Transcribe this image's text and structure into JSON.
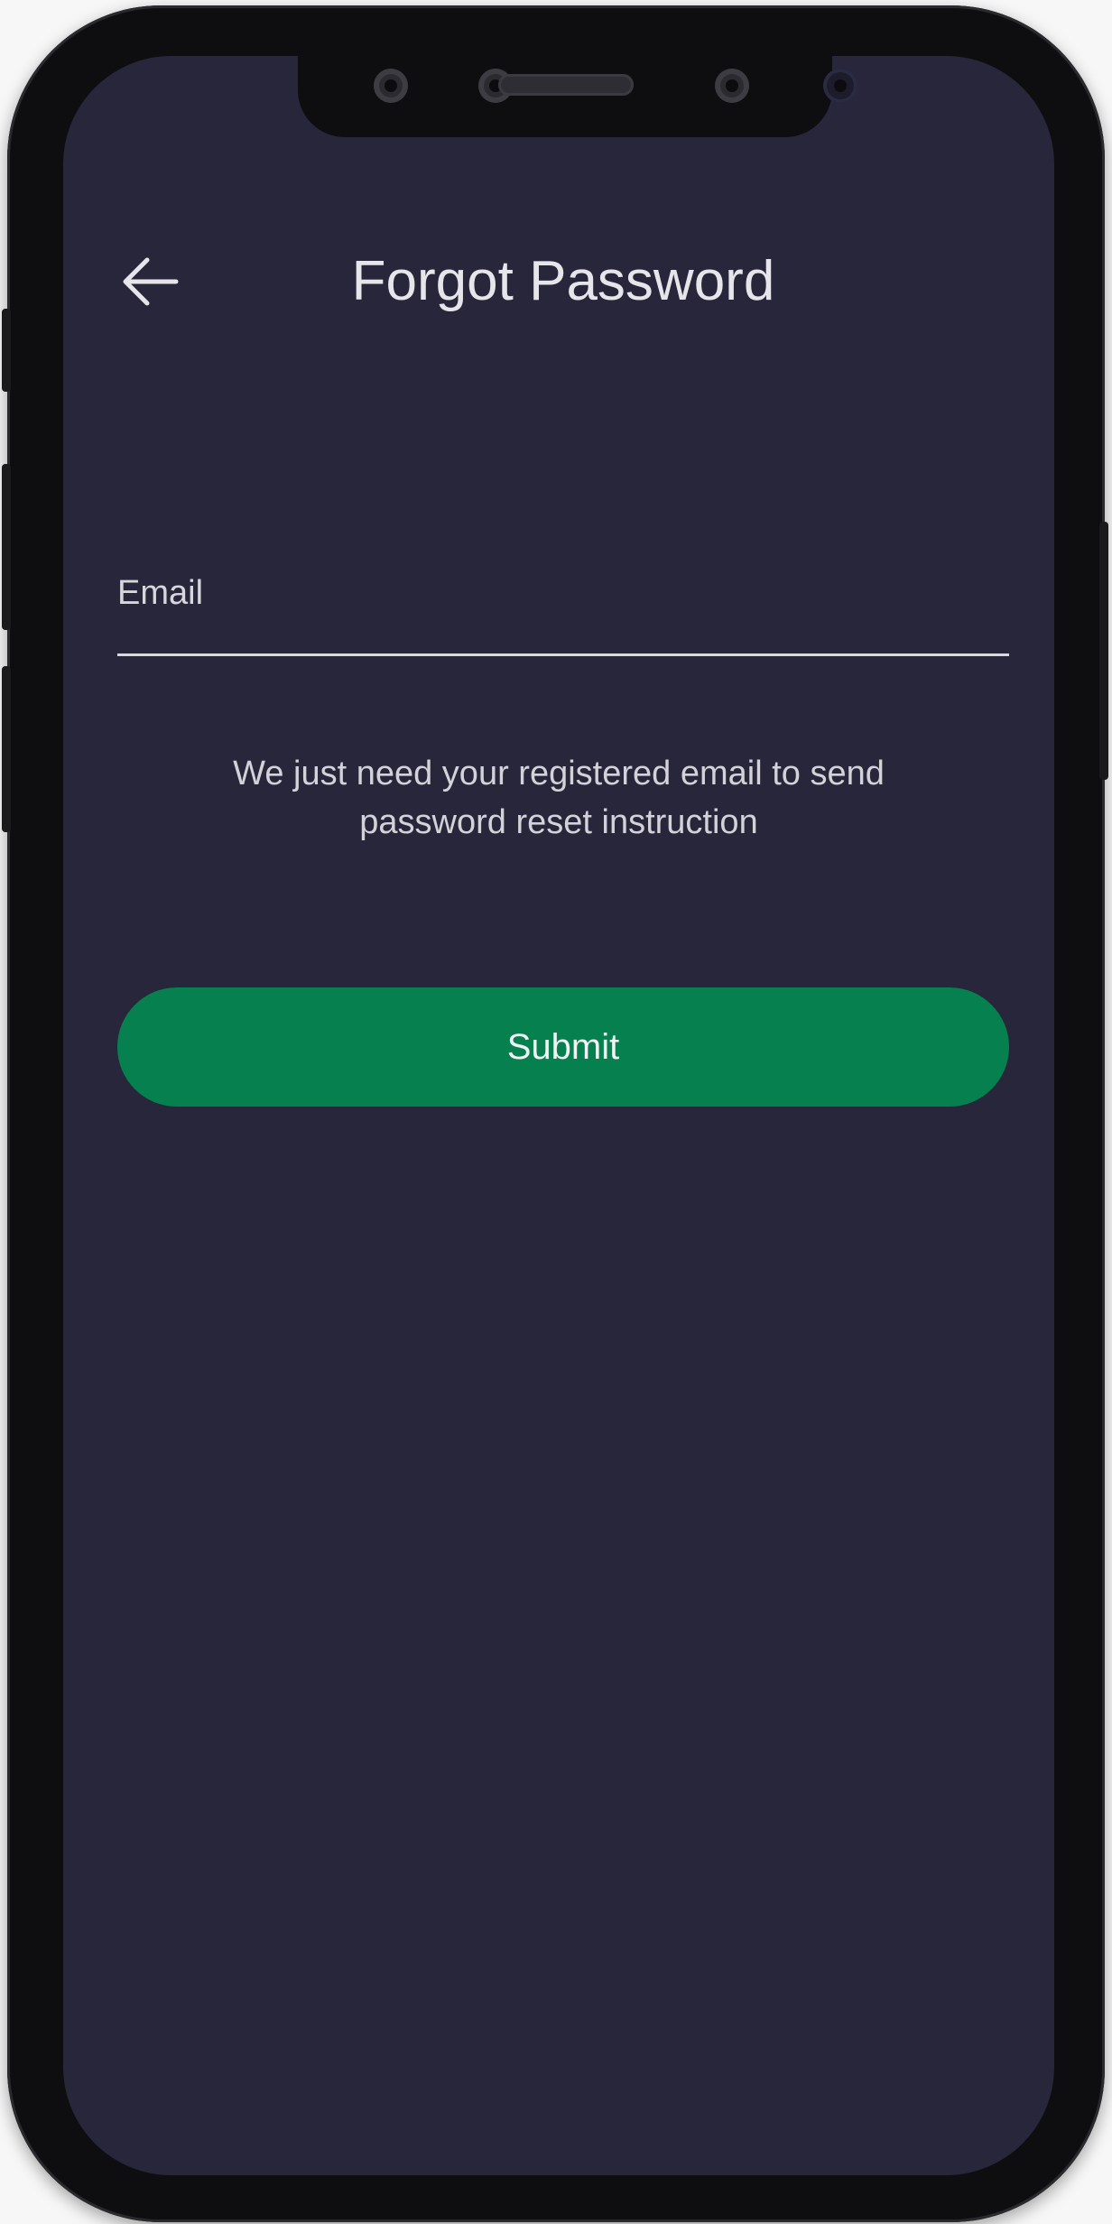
{
  "header": {
    "title": "Forgot Password",
    "back_icon": "arrow-left-icon"
  },
  "form": {
    "email_label": "Email",
    "email_value": "",
    "helper_text": "We just need your registered email to send password reset instruction",
    "submit_label": "Submit"
  },
  "colors": {
    "background": "#27263a",
    "accent": "#078050",
    "text": "#e6e6ea"
  }
}
